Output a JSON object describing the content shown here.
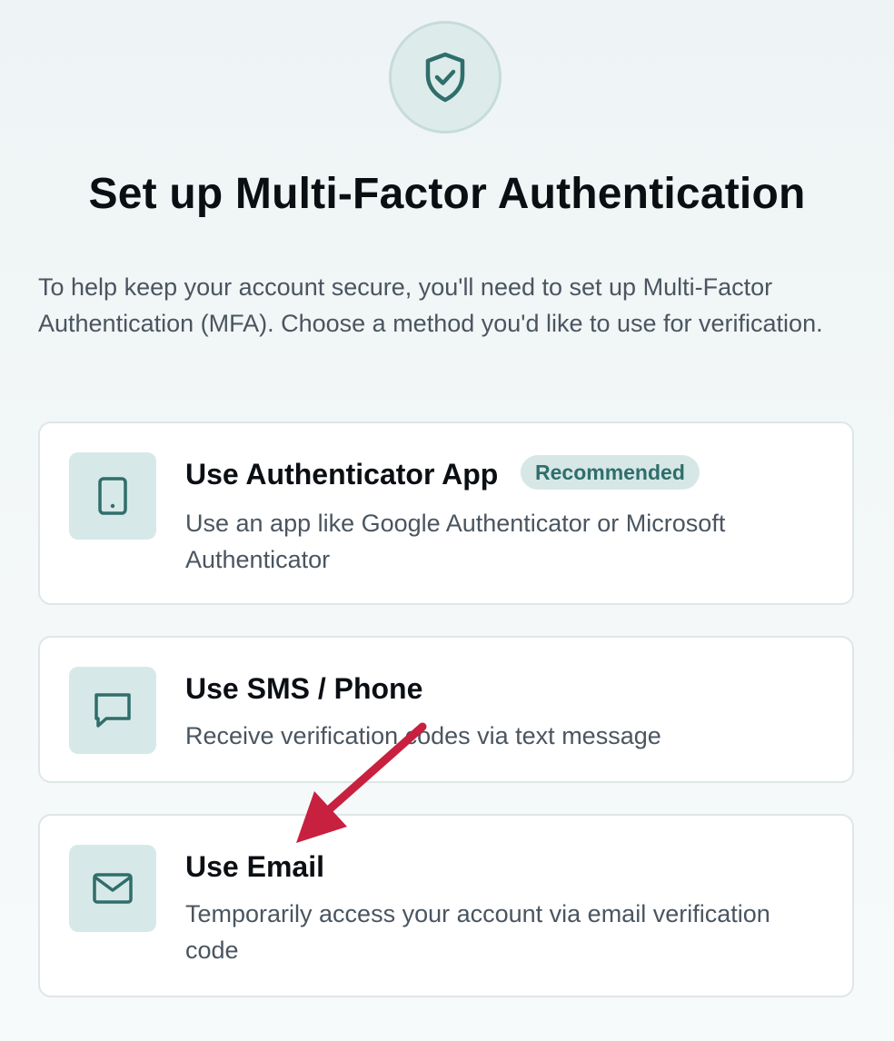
{
  "header": {
    "icon": "shield-check-icon",
    "title": "Set up Multi-Factor Authentication",
    "intro": "To help keep your account secure, you'll need to set up Multi-Factor Authentication (MFA). Choose a method you'd like to use for verification."
  },
  "options": [
    {
      "icon": "tablet-icon",
      "title": "Use Authenticator App",
      "badge": "Recommended",
      "description": "Use an app like Google Authenticator or Microsoft Authenticator"
    },
    {
      "icon": "message-bubble-icon",
      "title": "Use SMS / Phone",
      "description": "Receive verification codes via text message"
    },
    {
      "icon": "envelope-icon",
      "title": "Use Email",
      "description": "Temporarily access your account via email verification code"
    }
  ],
  "colors": {
    "accent": "#2f6e6b",
    "icon_bg": "#d7e8e8",
    "annotation_arrow": "#c8203f"
  }
}
